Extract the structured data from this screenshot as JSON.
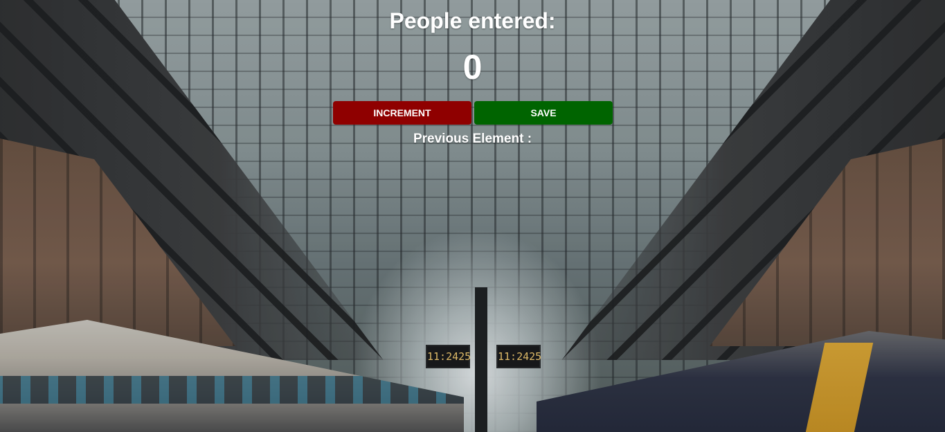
{
  "counter": {
    "title": "People entered:",
    "value": "0"
  },
  "actions": {
    "increment_label": "INCREMENT",
    "save_label": "SAVE"
  },
  "previous": {
    "label": "Previous Element :",
    "value": ""
  },
  "station_clocks": {
    "left_time": "11:2425",
    "right_time": "11:2425"
  },
  "colors": {
    "increment_button": "#8f0000",
    "save_button": "#006400",
    "text": "#ffffff"
  }
}
